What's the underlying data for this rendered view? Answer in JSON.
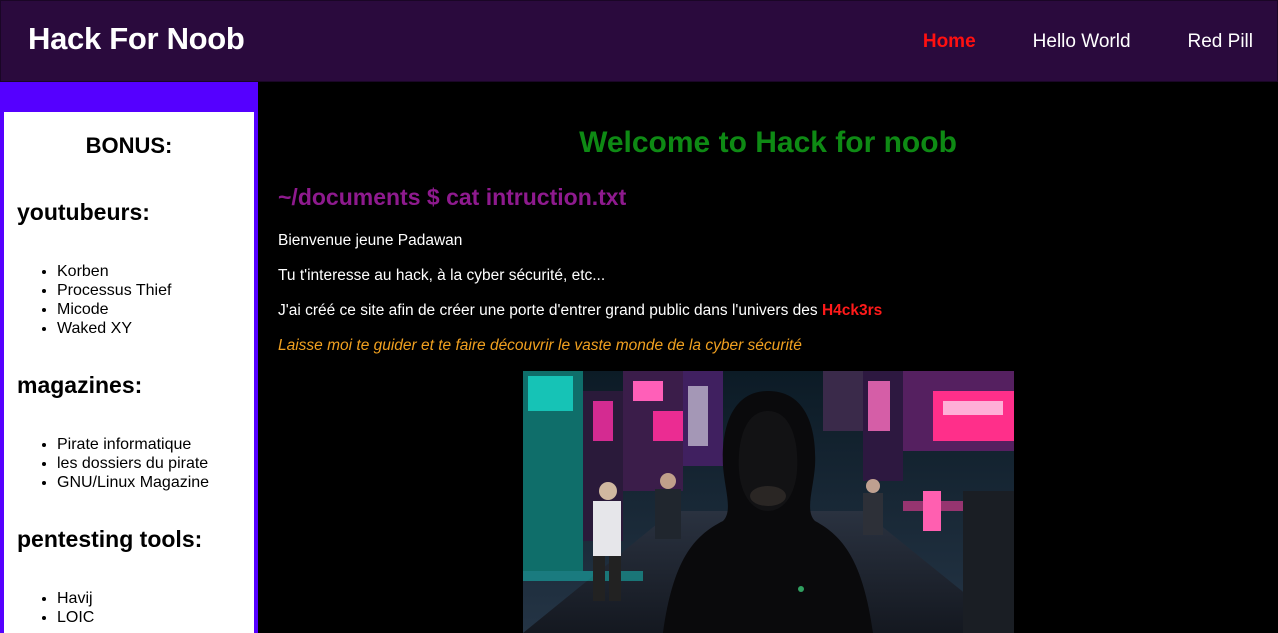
{
  "nav": {
    "brand": "Hack For Noob",
    "links": [
      "Home",
      "Hello World",
      "Red Pill"
    ]
  },
  "sidebar": {
    "title": "BONUS:",
    "sections": [
      {
        "title": "youtubeurs:",
        "items": [
          "Korben",
          "Processus Thief",
          "Micode",
          "Waked XY"
        ]
      },
      {
        "title": "magazines:",
        "items": [
          "Pirate informatique",
          "les dossiers du pirate",
          "GNU/Linux Magazine"
        ]
      },
      {
        "title": "pentesting tools:",
        "items": [
          "Havij",
          "LOIC"
        ]
      }
    ]
  },
  "main": {
    "welcome": "Welcome to Hack for noob",
    "command": "~/documents $ cat intruction.txt",
    "p1": "Bienvenue jeune Padawan",
    "p2": "Tu t'interesse au hack, à la cyber sécurité, etc...",
    "p3_text": "J'ai créé ce site afin de créer une porte d'entrer grand public dans l'univers des ",
    "p3_highlight": "H4ck3rs",
    "p4": "Laisse moi te guider et te faire découvrir le vaste monde de la cyber sécurité"
  },
  "colors": {
    "navbar": "#2a0a3d",
    "active_link": "#ff1010",
    "sidebar_frame": "#5500ff",
    "welcome": "#0e8a14",
    "command": "#8e1a8e",
    "italic": "#f0a020"
  }
}
